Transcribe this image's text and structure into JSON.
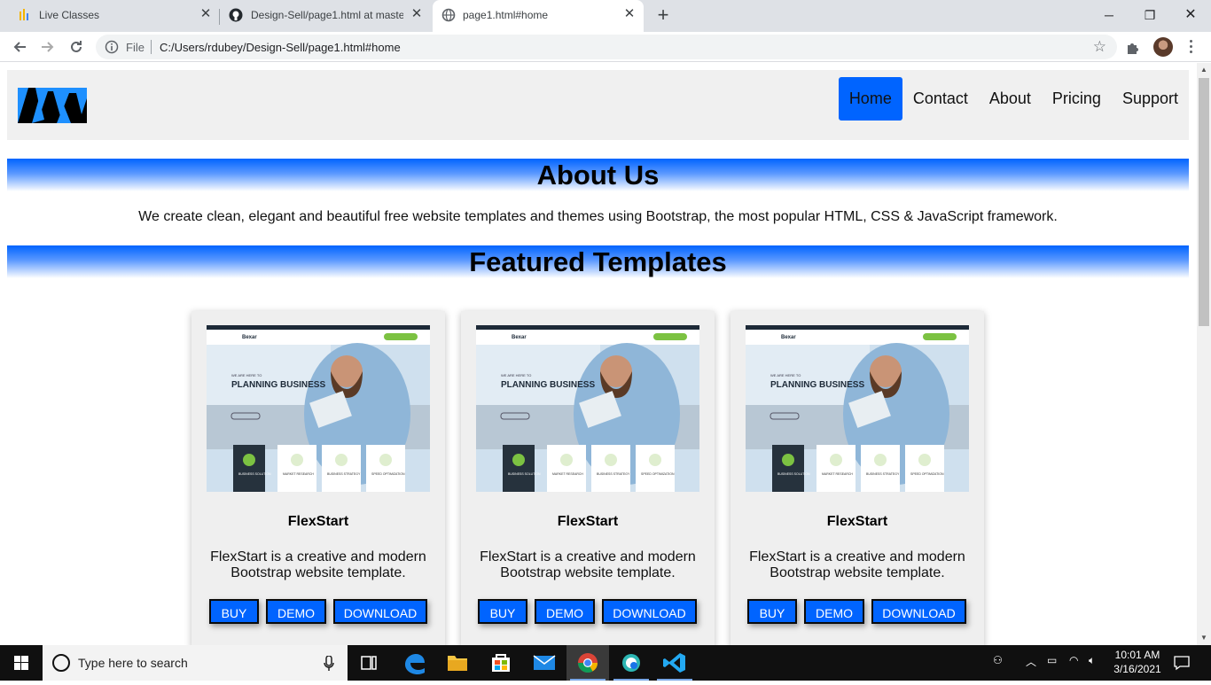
{
  "browser": {
    "tabs": [
      {
        "title": "Live Classes",
        "icon": "bar-chart-icon"
      },
      {
        "title": "Design-Sell/page1.html at maste",
        "icon": "github-icon"
      },
      {
        "title": "page1.html#home",
        "icon": "globe-icon",
        "active": true
      }
    ],
    "address": {
      "scheme_label": "File",
      "url": "C:/Users/rdubey/Design-Sell/page1.html#home"
    }
  },
  "site": {
    "nav": [
      "Home",
      "Contact",
      "About",
      "Pricing",
      "Support"
    ],
    "active_nav": "Home",
    "about_heading": "About Us",
    "about_text": "We create clean, elegant and beautiful free website templates and themes using Bootstrap, the most popular HTML, CSS & JavaScript framework.",
    "featured_heading": "Featured Templates",
    "cards": [
      {
        "title": "FlexStart",
        "description": "FlexStart is a creative and modern Bootstrap website template.",
        "buttons": [
          "BUY",
          "DEMO",
          "DOWNLOAD"
        ]
      },
      {
        "title": "FlexStart",
        "description": "FlexStart is a creative and modern Bootstrap website template.",
        "buttons": [
          "BUY",
          "DEMO",
          "DOWNLOAD"
        ]
      },
      {
        "title": "FlexStart",
        "description": "FlexStart is a creative and modern Bootstrap website template.",
        "buttons": [
          "BUY",
          "DEMO",
          "DOWNLOAD"
        ]
      }
    ],
    "preview": {
      "brand": "Bexar",
      "kicker": "WE ARE HERE TO",
      "headline": "PLANNING BUSINESS",
      "features": [
        "BUSINESS SOLUTION",
        "MARKET RESEARCH",
        "BUSINESS STRATEGY",
        "SPEED OPTIMIZATION"
      ]
    },
    "colors": {
      "primary": "#0064ff",
      "header_bg": "#f0f0f0",
      "card_bg": "#efefef",
      "logo": "#1e90ff"
    }
  },
  "taskbar": {
    "search_placeholder": "Type here to search",
    "apps": [
      "task-view-icon",
      "edge-icon",
      "file-explorer-icon",
      "store-icon",
      "mail-icon",
      "chrome-icon",
      "edge-dev-icon",
      "vscode-icon"
    ],
    "time": "10:01 AM",
    "date": "3/16/2021"
  }
}
